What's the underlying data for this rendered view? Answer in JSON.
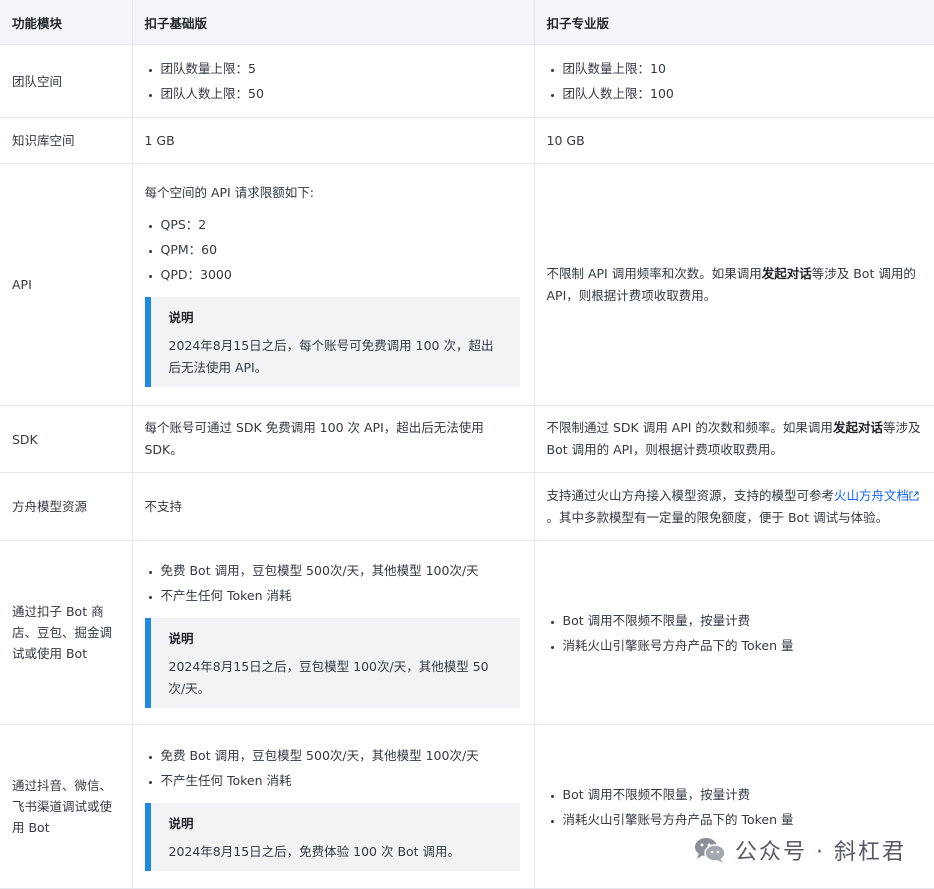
{
  "headers": [
    "功能模块",
    "扣子基础版",
    "扣子专业版"
  ],
  "rows": {
    "team": {
      "feature": "团队空间",
      "basic": [
        "团队数量上限：5",
        "团队人数上限：50"
      ],
      "pro": [
        "团队数量上限：10",
        "团队人数上限：100"
      ]
    },
    "kb": {
      "feature": "知识库空间",
      "basic": "1 GB",
      "pro": "10 GB"
    },
    "api": {
      "feature": "API",
      "basic_intro": "每个空间的 API 请求限额如下:",
      "basic_items": [
        "QPS：2",
        "QPM：60",
        "QPD：3000"
      ],
      "note_title": "说明",
      "note_body": "2024年8月15日之后，每个账号可免费调用 100 次，超出后无法使用 API。",
      "pro_before": "不限制 API 调用频率和次数。如果调用",
      "pro_bold": "发起对话",
      "pro_after": "等涉及 Bot 调用的 API，则根据计费项收取费用。"
    },
    "sdk": {
      "feature": "SDK",
      "basic": "每个账号可通过 SDK 免费调用 100 次 API，超出后无法使用 SDK。",
      "pro_before": "不限制通过 SDK 调用 API 的次数和频率。如果调用",
      "pro_bold": "发起对话",
      "pro_after": "等涉及 Bot 调用的 API，则根据计费项收取费用。"
    },
    "ark": {
      "feature": "方舟模型资源",
      "basic": "不支持",
      "pro_before": "支持通过火山方舟接入模型资源，支持的模型可参考",
      "pro_link": "火山方舟文档",
      "pro_after": "。其中多款模型有一定量的限免额度，便于 Bot 调试与体验。"
    },
    "store": {
      "feature": "通过扣子 Bot 商店、豆包、掘金调试或使用 Bot",
      "basic_items": [
        "免费 Bot 调用，豆包模型 500次/天，其他模型 100次/天",
        "不产生任何 Token 消耗"
      ],
      "note_title": "说明",
      "note_body": "2024年8月15日之后，豆包模型 100次/天，其他模型 50次/天。",
      "pro_items": [
        "Bot 调用不限频不限量，按量计费",
        "消耗火山引擎账号方舟产品下的 Token 量"
      ]
    },
    "channels": {
      "feature": "通过抖音、微信、飞书渠道调试或使用 Bot",
      "basic_items": [
        "免费 Bot 调用，豆包模型 500次/天，其他模型 100次/天",
        "不产生任何 Token 消耗"
      ],
      "note_title": "说明",
      "note_body": "2024年8月15日之后，免费体验 100 次 Bot 调用。",
      "pro_items": [
        "Bot 调用不限频不限量，按量计费",
        "消耗火山引擎账号方舟产品下的 Token 量"
      ]
    }
  },
  "watermark": {
    "text": "公众号 · 斜杠君",
    "icon": "wechat-icon"
  }
}
